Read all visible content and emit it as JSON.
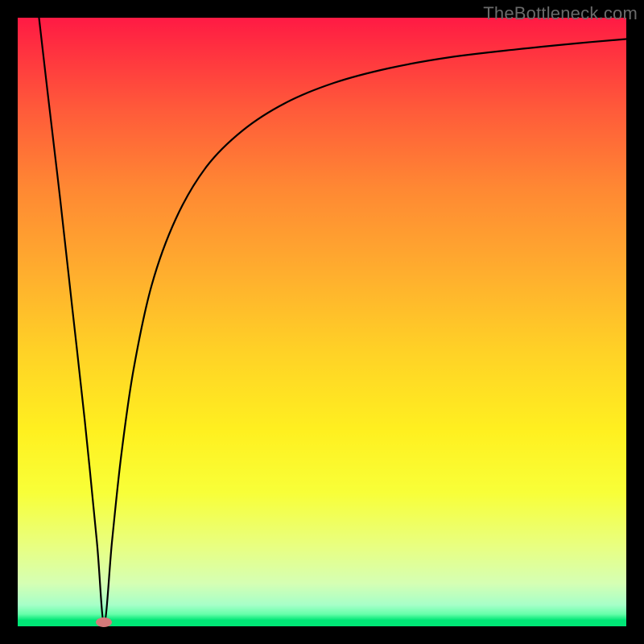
{
  "watermark": "TheBottleneck.com",
  "chart_data": {
    "type": "line",
    "title": "",
    "xlabel": "",
    "ylabel": "",
    "xlim": [
      0,
      100
    ],
    "ylim": [
      0,
      100
    ],
    "grid": false,
    "legend": false,
    "marker": {
      "x": 14.2,
      "y": 0.6,
      "color": "#d47a7a"
    },
    "gradient_stops": [
      {
        "pos": 0.0,
        "color": "#ff1a44"
      },
      {
        "pos": 0.05,
        "color": "#ff3040"
      },
      {
        "pos": 0.15,
        "color": "#ff5a3a"
      },
      {
        "pos": 0.28,
        "color": "#ff8833"
      },
      {
        "pos": 0.42,
        "color": "#ffae2e"
      },
      {
        "pos": 0.55,
        "color": "#ffd226"
      },
      {
        "pos": 0.68,
        "color": "#fff020"
      },
      {
        "pos": 0.78,
        "color": "#f8ff38"
      },
      {
        "pos": 0.87,
        "color": "#e8ff82"
      },
      {
        "pos": 0.93,
        "color": "#d5ffb4"
      },
      {
        "pos": 0.965,
        "color": "#a6ffc8"
      },
      {
        "pos": 0.98,
        "color": "#66ffaa"
      },
      {
        "pos": 0.99,
        "color": "#00e676"
      },
      {
        "pos": 1.0,
        "color": "#00e676"
      }
    ],
    "series": [
      {
        "name": "curve",
        "x": [
          3.5,
          5,
          7,
          9,
          11,
          13,
          14.2,
          15.5,
          17,
          19,
          22,
          26,
          31,
          37,
          44,
          52,
          61,
          71,
          82,
          92,
          100
        ],
        "y": [
          100,
          87,
          70,
          52,
          34,
          14,
          0.6,
          14,
          28,
          42,
          56,
          67,
          75.5,
          81.5,
          86,
          89.3,
          91.7,
          93.5,
          94.8,
          95.8,
          96.5
        ]
      }
    ]
  }
}
